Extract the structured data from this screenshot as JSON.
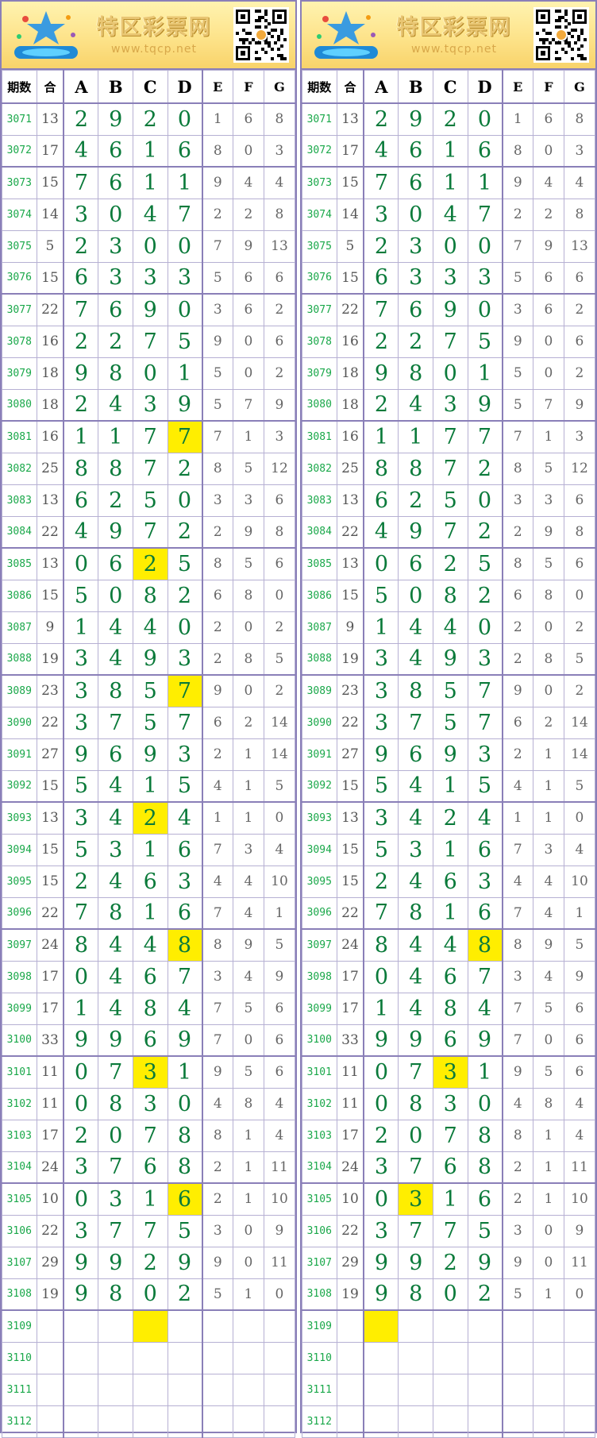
{
  "site": {
    "brand": "特区彩票网",
    "url": "www.tqcp.net"
  },
  "headers": [
    "期数",
    "合",
    "A",
    "B",
    "C",
    "D",
    "E",
    "F",
    "G"
  ],
  "colors": {
    "digit": "#0a7a3a",
    "issue": "#1aa84a",
    "highlight": "#ffee00",
    "border": "#8a7fb8"
  },
  "rows": [
    {
      "issue": "3071",
      "sum": "13",
      "abcd": [
        "2",
        "9",
        "2",
        "0"
      ],
      "efg": [
        "1",
        "6",
        "8"
      ]
    },
    {
      "issue": "3072",
      "sum": "17",
      "abcd": [
        "4",
        "6",
        "1",
        "6"
      ],
      "efg": [
        "8",
        "0",
        "3"
      ]
    },
    {
      "issue": "3073",
      "sum": "15",
      "abcd": [
        "7",
        "6",
        "1",
        "1"
      ],
      "efg": [
        "9",
        "4",
        "4"
      ]
    },
    {
      "issue": "3074",
      "sum": "14",
      "abcd": [
        "3",
        "0",
        "4",
        "7"
      ],
      "efg": [
        "2",
        "2",
        "8"
      ]
    },
    {
      "issue": "3075",
      "sum": "5",
      "abcd": [
        "2",
        "3",
        "0",
        "0"
      ],
      "efg": [
        "7",
        "9",
        "13"
      ]
    },
    {
      "issue": "3076",
      "sum": "15",
      "abcd": [
        "6",
        "3",
        "3",
        "3"
      ],
      "efg": [
        "5",
        "6",
        "6"
      ]
    },
    {
      "issue": "3077",
      "sum": "22",
      "abcd": [
        "7",
        "6",
        "9",
        "0"
      ],
      "efg": [
        "3",
        "6",
        "2"
      ]
    },
    {
      "issue": "3078",
      "sum": "16",
      "abcd": [
        "2",
        "2",
        "7",
        "5"
      ],
      "efg": [
        "9",
        "0",
        "6"
      ]
    },
    {
      "issue": "3079",
      "sum": "18",
      "abcd": [
        "9",
        "8",
        "0",
        "1"
      ],
      "efg": [
        "5",
        "0",
        "2"
      ]
    },
    {
      "issue": "3080",
      "sum": "18",
      "abcd": [
        "2",
        "4",
        "3",
        "9"
      ],
      "efg": [
        "5",
        "7",
        "9"
      ]
    },
    {
      "issue": "3081",
      "sum": "16",
      "abcd": [
        "1",
        "1",
        "7",
        "7"
      ],
      "efg": [
        "7",
        "1",
        "3"
      ]
    },
    {
      "issue": "3082",
      "sum": "25",
      "abcd": [
        "8",
        "8",
        "7",
        "2"
      ],
      "efg": [
        "8",
        "5",
        "12"
      ]
    },
    {
      "issue": "3083",
      "sum": "13",
      "abcd": [
        "6",
        "2",
        "5",
        "0"
      ],
      "efg": [
        "3",
        "3",
        "6"
      ]
    },
    {
      "issue": "3084",
      "sum": "22",
      "abcd": [
        "4",
        "9",
        "7",
        "2"
      ],
      "efg": [
        "2",
        "9",
        "8"
      ]
    },
    {
      "issue": "3085",
      "sum": "13",
      "abcd": [
        "0",
        "6",
        "2",
        "5"
      ],
      "efg": [
        "8",
        "5",
        "6"
      ]
    },
    {
      "issue": "3086",
      "sum": "15",
      "abcd": [
        "5",
        "0",
        "8",
        "2"
      ],
      "efg": [
        "6",
        "8",
        "0"
      ]
    },
    {
      "issue": "3087",
      "sum": "9",
      "abcd": [
        "1",
        "4",
        "4",
        "0"
      ],
      "efg": [
        "2",
        "0",
        "2"
      ]
    },
    {
      "issue": "3088",
      "sum": "19",
      "abcd": [
        "3",
        "4",
        "9",
        "3"
      ],
      "efg": [
        "2",
        "8",
        "5"
      ]
    },
    {
      "issue": "3089",
      "sum": "23",
      "abcd": [
        "3",
        "8",
        "5",
        "7"
      ],
      "efg": [
        "9",
        "0",
        "2"
      ]
    },
    {
      "issue": "3090",
      "sum": "22",
      "abcd": [
        "3",
        "7",
        "5",
        "7"
      ],
      "efg": [
        "6",
        "2",
        "14"
      ]
    },
    {
      "issue": "3091",
      "sum": "27",
      "abcd": [
        "9",
        "6",
        "9",
        "3"
      ],
      "efg": [
        "2",
        "1",
        "14"
      ]
    },
    {
      "issue": "3092",
      "sum": "15",
      "abcd": [
        "5",
        "4",
        "1",
        "5"
      ],
      "efg": [
        "4",
        "1",
        "5"
      ]
    },
    {
      "issue": "3093",
      "sum": "13",
      "abcd": [
        "3",
        "4",
        "2",
        "4"
      ],
      "efg": [
        "1",
        "1",
        "0"
      ]
    },
    {
      "issue": "3094",
      "sum": "15",
      "abcd": [
        "5",
        "3",
        "1",
        "6"
      ],
      "efg": [
        "7",
        "3",
        "4"
      ]
    },
    {
      "issue": "3095",
      "sum": "15",
      "abcd": [
        "2",
        "4",
        "6",
        "3"
      ],
      "efg": [
        "4",
        "4",
        "10"
      ]
    },
    {
      "issue": "3096",
      "sum": "22",
      "abcd": [
        "7",
        "8",
        "1",
        "6"
      ],
      "efg": [
        "7",
        "4",
        "1"
      ]
    },
    {
      "issue": "3097",
      "sum": "24",
      "abcd": [
        "8",
        "4",
        "4",
        "8"
      ],
      "efg": [
        "8",
        "9",
        "5"
      ]
    },
    {
      "issue": "3098",
      "sum": "17",
      "abcd": [
        "0",
        "4",
        "6",
        "7"
      ],
      "efg": [
        "3",
        "4",
        "9"
      ]
    },
    {
      "issue": "3099",
      "sum": "17",
      "abcd": [
        "1",
        "4",
        "8",
        "4"
      ],
      "efg": [
        "7",
        "5",
        "6"
      ]
    },
    {
      "issue": "3100",
      "sum": "33",
      "abcd": [
        "9",
        "9",
        "6",
        "9"
      ],
      "efg": [
        "7",
        "0",
        "6"
      ]
    },
    {
      "issue": "3101",
      "sum": "11",
      "abcd": [
        "0",
        "7",
        "3",
        "1"
      ],
      "efg": [
        "9",
        "5",
        "6"
      ]
    },
    {
      "issue": "3102",
      "sum": "11",
      "abcd": [
        "0",
        "8",
        "3",
        "0"
      ],
      "efg": [
        "4",
        "8",
        "4"
      ]
    },
    {
      "issue": "3103",
      "sum": "17",
      "abcd": [
        "2",
        "0",
        "7",
        "8"
      ],
      "efg": [
        "8",
        "1",
        "4"
      ]
    },
    {
      "issue": "3104",
      "sum": "24",
      "abcd": [
        "3",
        "7",
        "6",
        "8"
      ],
      "efg": [
        "2",
        "1",
        "11"
      ]
    },
    {
      "issue": "3105",
      "sum": "10",
      "abcd": [
        "0",
        "3",
        "1",
        "6"
      ],
      "efg": [
        "2",
        "1",
        "10"
      ]
    },
    {
      "issue": "3106",
      "sum": "22",
      "abcd": [
        "3",
        "7",
        "7",
        "5"
      ],
      "efg": [
        "3",
        "0",
        "9"
      ]
    },
    {
      "issue": "3107",
      "sum": "29",
      "abcd": [
        "9",
        "9",
        "2",
        "9"
      ],
      "efg": [
        "9",
        "0",
        "11"
      ]
    },
    {
      "issue": "3108",
      "sum": "19",
      "abcd": [
        "9",
        "8",
        "0",
        "2"
      ],
      "efg": [
        "5",
        "1",
        "0"
      ]
    },
    {
      "issue": "3109",
      "sum": "",
      "abcd": [
        "",
        "",
        "",
        ""
      ],
      "efg": [
        "",
        "",
        ""
      ]
    },
    {
      "issue": "3110",
      "sum": "",
      "abcd": [
        "",
        "",
        "",
        ""
      ],
      "efg": [
        "",
        "",
        ""
      ]
    },
    {
      "issue": "3111",
      "sum": "",
      "abcd": [
        "",
        "",
        "",
        ""
      ],
      "efg": [
        "",
        "",
        ""
      ]
    },
    {
      "issue": "3112",
      "sum": "",
      "abcd": [
        "",
        "",
        "",
        ""
      ],
      "efg": [
        "",
        "",
        ""
      ]
    }
  ],
  "panels": [
    {
      "highlights": [
        [
          10,
          3
        ],
        [
          14,
          2
        ],
        [
          18,
          3
        ],
        [
          22,
          2
        ],
        [
          26,
          3
        ],
        [
          30,
          2
        ],
        [
          34,
          3
        ],
        [
          38,
          2
        ]
      ]
    },
    {
      "highlights": [
        [
          26,
          3
        ],
        [
          30,
          2
        ],
        [
          34,
          1
        ],
        [
          38,
          0
        ]
      ]
    }
  ]
}
